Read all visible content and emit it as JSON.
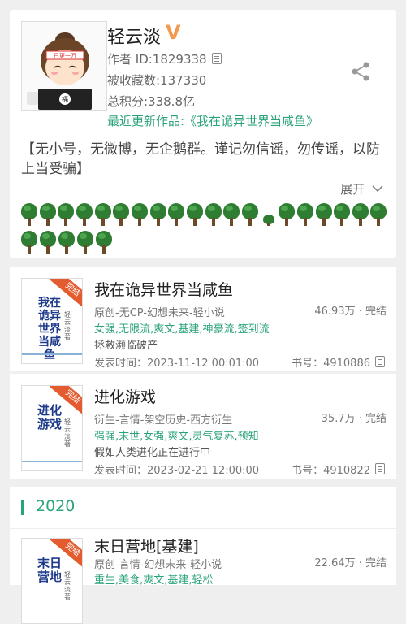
{
  "author": {
    "name": "轻云淡",
    "verified_badge": "V",
    "id_label": "作者 ID:1829338",
    "collections_label": "被收藏数:137330",
    "points_label": "总积分:338.8亿",
    "latest_label": "最近更新作品:《我在诡异世界当咸鱼》",
    "notice": "【无小号，无微博，无企鹅群。谨记勿信谣，勿传谣，以防上当受骗】",
    "expand_label": "展开",
    "avatar_sign": "日更一万",
    "avatar_badge": "福"
  },
  "trees": {
    "row1": [
      "tree",
      "tree",
      "tree",
      "tree",
      "tree",
      "tree",
      "tree",
      "tree",
      "tree",
      "tree",
      "tree",
      "tree",
      "tree",
      "small",
      "tree",
      "tree",
      "tree",
      "tree",
      "tree",
      "tree"
    ],
    "row2": [
      "tree",
      "tree",
      "tree",
      "tree",
      "tree"
    ]
  },
  "books": [
    {
      "cover_title": "我在诡异世界当咸鱼",
      "cover_author": "轻云淡著",
      "ribbon": "完结",
      "title": "我在诡异世界当咸鱼",
      "genre": "原创-无CP-幻想未来-轻小说",
      "words": "46.93万 · 完结",
      "tags": "女强,无限流,爽文,基建,神豪流,签到流",
      "desc": "拯救濒临破产",
      "date": "发表时间：2023-11-12 00:01:00",
      "book_id": "书号：4910886"
    },
    {
      "cover_title": "进化游戏",
      "cover_author": "轻云淡著",
      "ribbon": "完结",
      "title": "进化游戏",
      "genre": "衍生-言情-架空历史-西方衍生",
      "words": "35.7万 · 完结",
      "tags": "强强,末世,女强,爽文,灵气复苏,预知",
      "desc": "假如人类进化正在进行中",
      "date": "发表时间：2023-02-21 12:00:00",
      "book_id": "书号：4910822"
    },
    {
      "cover_title": "末日营地",
      "cover_author": "轻云淡著",
      "ribbon": "完结",
      "title": "末日营地[基建]",
      "genre": "原创-言情-幻想未来-轻小说",
      "words": "22.64万 · 完结",
      "tags": "重生,美食,爽文,基建,轻松"
    }
  ],
  "year_section": {
    "label": "2020"
  },
  "colors": {
    "accent": "#2ba37a",
    "badge": "#f29b4f",
    "ribbon": "#e35b2e"
  },
  "icons": {
    "share": "share-icon",
    "copy": "copy-icon",
    "chevron": "chevron-down-icon"
  }
}
